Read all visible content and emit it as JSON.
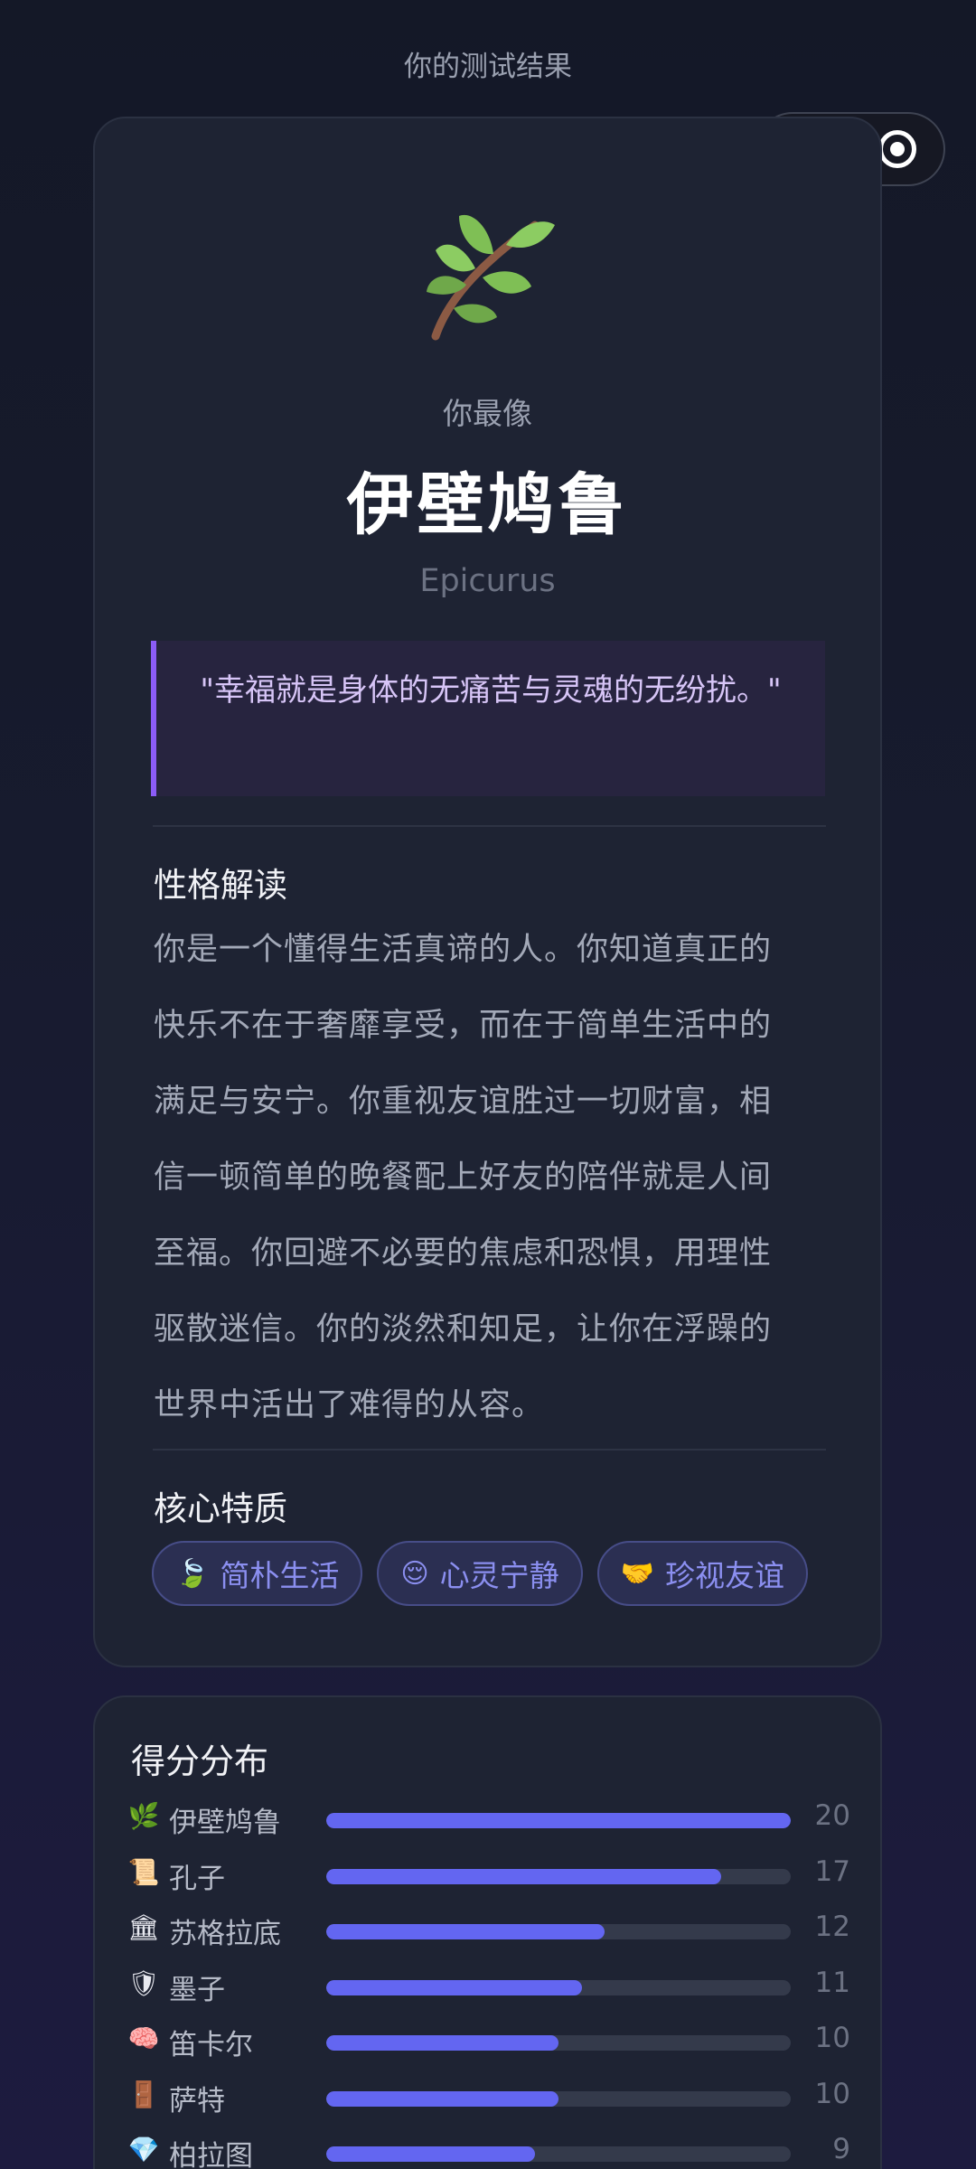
{
  "header": {
    "title": "你的测试结果"
  },
  "capsule": {
    "more_icon": "more-dots-icon",
    "close_icon": "target-circle-icon"
  },
  "result": {
    "icon": "leaf-branch-icon",
    "lead": "你最像",
    "name": "伊壁鸠鲁",
    "name_en": "Epicurus",
    "quote": "\"幸福就是身体的无痛苦与灵魂的无纷扰。\"",
    "personality_title": "性格解读",
    "personality_text": "你是一个懂得生活真谛的人。你知道真正的快乐不在于奢靡享受，而在于简单生活中的满足与安宁。你重视友谊胜过一切财富，相信一顿简单的晚餐配上好友的陪伴就是人间至福。你回避不必要的焦虑和恐惧，用理性驱散迷信。你的淡然和知足，让你在浮躁的世界中活出了难得的从容。",
    "traits_title": "核心特质",
    "traits": [
      {
        "emoji": "🍃",
        "label": "简朴生活"
      },
      {
        "emoji": "😌",
        "label": "心灵宁静"
      },
      {
        "emoji": "🤝",
        "label": "珍视友谊"
      }
    ]
  },
  "scores": {
    "title": "得分分布",
    "max": 20,
    "accent": "#6366f1",
    "items": [
      {
        "emoji": "🌿",
        "name": "伊壁鸠鲁",
        "value": 20
      },
      {
        "emoji": "📜",
        "name": "孔子",
        "value": 17
      },
      {
        "emoji": "🏛",
        "name": "苏格拉底",
        "value": 12
      },
      {
        "emoji": "🛡",
        "name": "墨子",
        "value": 11
      },
      {
        "emoji": "🧠",
        "name": "笛卡尔",
        "value": 10
      },
      {
        "emoji": "🚪",
        "name": "萨特",
        "value": 10
      },
      {
        "emoji": "💎",
        "name": "柏拉图",
        "value": 9
      }
    ]
  }
}
